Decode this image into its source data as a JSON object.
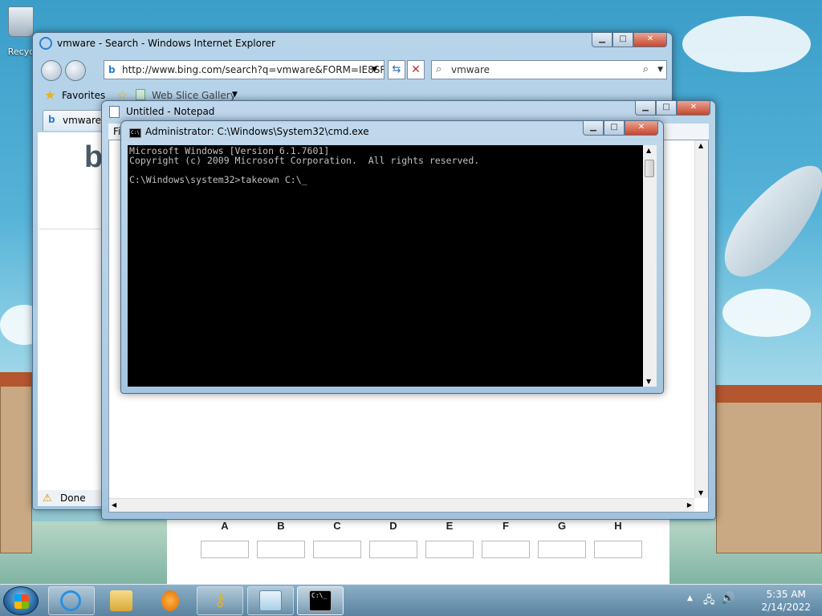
{
  "desktop": {
    "recycle_label": "Recyc"
  },
  "ie": {
    "title": "vmware - Search - Windows Internet Explorer",
    "address": "http://www.bing.com/search?q=vmware&FORM=IE8SRC",
    "search_value": "vmware",
    "favorites_label": "Favorites",
    "web_slice_label": "Web Slice Gallery",
    "tab_label": "vmware -",
    "status": "Done"
  },
  "notepad": {
    "title": "Untitled - Notepad",
    "menu_first": "Fi"
  },
  "cmd": {
    "title": "Administrator: C:\\Windows\\System32\\cmd.exe",
    "lines": [
      "Microsoft Windows [Version 6.1.7601]",
      "Copyright (c) 2009 Microsoft Corporation.  All rights reserved.",
      "",
      "C:\\Windows\\system32>takeown C:\\_"
    ],
    "icon_text": "C:\\"
  },
  "form_grid": {
    "columns": [
      "A",
      "B",
      "C",
      "D",
      "E",
      "F",
      "G",
      "H"
    ]
  },
  "taskbar": {
    "time": "5:35 AM",
    "date": "2/14/2022",
    "cmd_icon_text": "C:\\_"
  }
}
